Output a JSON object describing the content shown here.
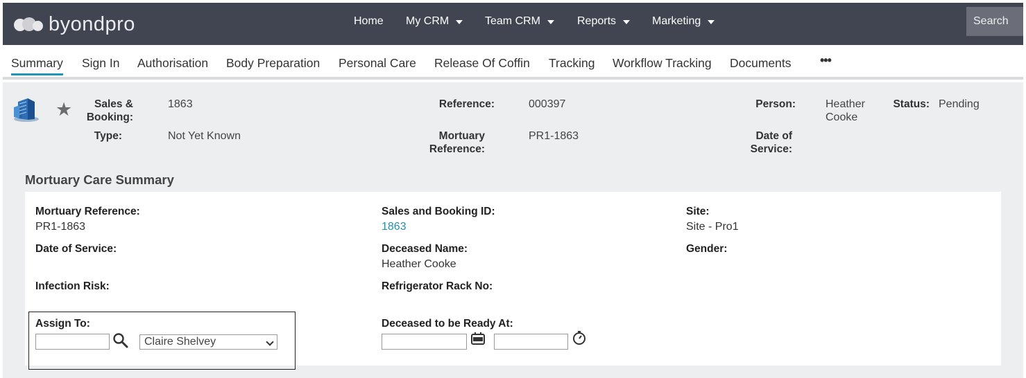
{
  "brand": {
    "name": "byondpro"
  },
  "nav": {
    "items": [
      {
        "label": "Home",
        "dropdown": false
      },
      {
        "label": "My CRM",
        "dropdown": true
      },
      {
        "label": "Team CRM",
        "dropdown": true
      },
      {
        "label": "Reports",
        "dropdown": true
      },
      {
        "label": "Marketing",
        "dropdown": true
      }
    ],
    "search_label": "Search"
  },
  "tabs": [
    {
      "label": "Summary",
      "active": true
    },
    {
      "label": "Sign In"
    },
    {
      "label": "Authorisation"
    },
    {
      "label": "Body Preparation"
    },
    {
      "label": "Personal Care"
    },
    {
      "label": "Release Of Coffin"
    },
    {
      "label": "Tracking"
    },
    {
      "label": "Workflow Tracking"
    },
    {
      "label": "Documents"
    }
  ],
  "more_label": "•••",
  "header": {
    "sales_booking_label_1": "Sales &",
    "sales_booking_label_2": "Booking:",
    "sales_booking_value": "1863",
    "type_label": "Type:",
    "type_value": "Not Yet Known",
    "reference_label": "Reference:",
    "reference_value": "000397",
    "mortuary_ref_label_1": "Mortuary",
    "mortuary_ref_label_2": "Reference:",
    "mortuary_ref_value": "PR1-1863",
    "person_label": "Person:",
    "person_value_1": "Heather",
    "person_value_2": "Cooke",
    "status_label": "Status:",
    "status_value": "Pending",
    "dos_label_1": "Date of",
    "dos_label_2": "Service:"
  },
  "summary": {
    "title": "Mortuary Care Summary",
    "mortuary_reference_label": "Mortuary Reference:",
    "mortuary_reference_value": "PR1-1863",
    "sales_booking_id_label": "Sales and Booking ID:",
    "sales_booking_id_value": "1863",
    "site_label": "Site:",
    "site_value": "Site - Pro1",
    "date_of_service_label": "Date of Service:",
    "deceased_name_label": "Deceased Name:",
    "deceased_name_value": "Heather Cooke",
    "gender_label": "Gender:",
    "infection_risk_label": "Infection Risk:",
    "refrigerator_rack_label": "Refrigerator Rack No:",
    "assign_to_label": "Assign To:",
    "assign_to_input_value": "",
    "assign_to_selected": "Claire Shelvey",
    "ready_at_label": "Deceased to be Ready At:",
    "ready_date_value": "",
    "ready_time_value": ""
  },
  "colors": {
    "topbar": "#414552",
    "accent": "#2196b8",
    "link": "#2291b0",
    "content_bg": "#eceef0"
  }
}
